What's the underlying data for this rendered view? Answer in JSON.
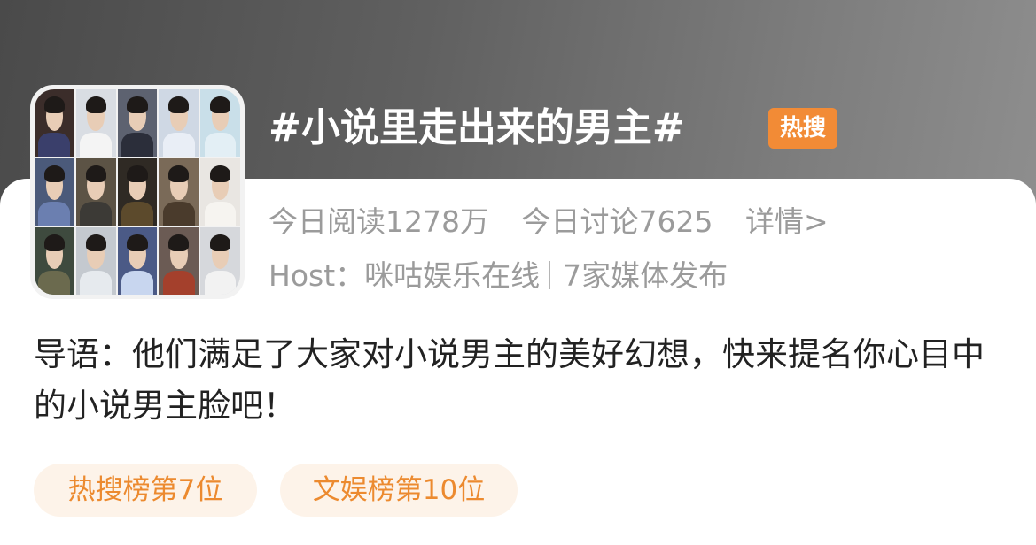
{
  "topic": {
    "title": "#小说里走出来的男主#",
    "badge": "热搜"
  },
  "stats": {
    "reads": "今日阅读1278万",
    "discussions": "今日讨论7625",
    "details_link": "详情>"
  },
  "host": {
    "host_text": "Host：咪咕娱乐在线",
    "media_text": "7家媒体发布"
  },
  "intro": {
    "text": "导语：他们满足了大家对小说男主的美好幻想，快来提名你心目中的小说男主脸吧！"
  },
  "tags": [
    {
      "label": "热搜榜第7位"
    },
    {
      "label": "文娱榜第10位"
    }
  ],
  "colors": {
    "accent_orange": "#f28b36",
    "tag_text": "#ec8a2f",
    "tag_bg": "#fdf3e9",
    "muted_text": "#9b9b9b",
    "body_text": "#222222"
  },
  "cover": {
    "tiles": [
      {
        "bg": "#3b2d2a",
        "robe": "#3a3f6b"
      },
      {
        "bg": "#d9dde3",
        "robe": "#f4f4f4"
      },
      {
        "bg": "#5d6270",
        "robe": "#2b2e3a"
      },
      {
        "bg": "#cfd8e4",
        "robe": "#e9eef6"
      },
      {
        "bg": "#c9dfe9",
        "robe": "#e3eff5"
      },
      {
        "bg": "#4b5a7a",
        "robe": "#6b7fb0"
      },
      {
        "bg": "#5c5345",
        "robe": "#3c3a36"
      },
      {
        "bg": "#2f2a24",
        "robe": "#5c4a2c"
      },
      {
        "bg": "#7a6a58",
        "robe": "#4a3b2c"
      },
      {
        "bg": "#e9e6e2",
        "robe": "#f6f4f0"
      },
      {
        "bg": "#3e4a3e",
        "robe": "#6b6a4e"
      },
      {
        "bg": "#c4c9cf",
        "robe": "#e6eaee"
      },
      {
        "bg": "#4b5a86",
        "robe": "#c8d6ef"
      },
      {
        "bg": "#6b5b54",
        "robe": "#a4402c"
      },
      {
        "bg": "#d6d8dc",
        "robe": "#f2f2f2"
      }
    ]
  }
}
